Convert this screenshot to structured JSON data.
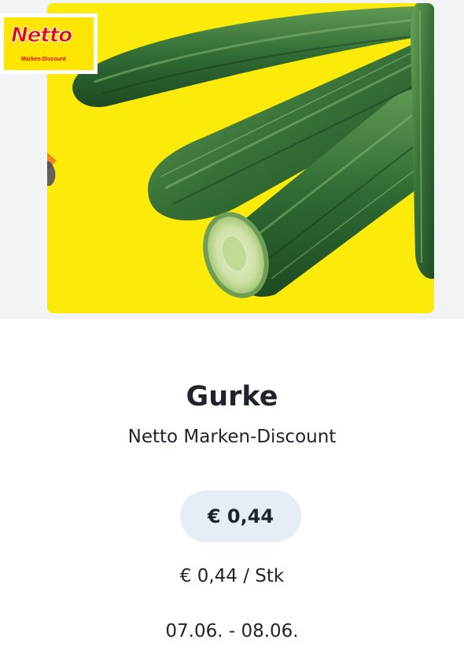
{
  "offer": {
    "product_name": "Gurke",
    "retailer": "Netto Marken-Discount",
    "price": "€ 0,44",
    "unit_price": "€ 0,44 / Stk",
    "validity": "07.06. - 08.06."
  },
  "logo": {
    "wordmark": "Netto",
    "tagline": "Marken-Discount"
  },
  "image": {
    "subject": "cucumbers",
    "background_color": "#fbea0a"
  },
  "colors": {
    "text": "#1f232b",
    "price_pill": "#e6edf7",
    "brand_red": "#e3001b",
    "brand_yellow": "#ffe500"
  }
}
